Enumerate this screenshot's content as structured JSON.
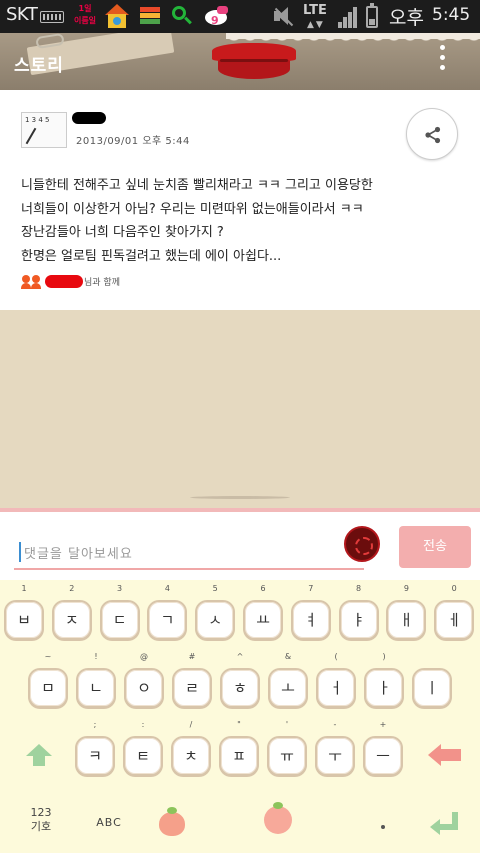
{
  "status_bar": {
    "carrier": "SKT",
    "calendar_day": "1일",
    "calendar_weekday": "이름일",
    "kitty_badge": "9",
    "network": "LTE",
    "ampm": "오후",
    "time": "5:45"
  },
  "app_bar": {
    "title": "스토리"
  },
  "post": {
    "date": "2013/09/01 오후 5:44",
    "thumbnail_text": "1 3 4 5",
    "lines": [
      "니들한테 전해주고 싶네 눈치좀 빨리채라고 ㅋㅋ 그리고 이용당한",
      "너희들이 이상한거 아님? 우리는 미련따위 없는애들이라서 ㅋㅋ",
      "장난감들아 너희 다음주인 찾아가지 ?",
      "한명은 얼로팀 핀독걸려고 했는데 에이 아쉽다..."
    ],
    "tag_suffix": "님과 함께"
  },
  "comment_bar": {
    "placeholder": "댓글을 달아보세요",
    "send_label": "전송"
  },
  "keyboard": {
    "row1": [
      {
        "key": "ㅂ",
        "hint": "1"
      },
      {
        "key": "ㅈ",
        "hint": "2"
      },
      {
        "key": "ㄷ",
        "hint": "3"
      },
      {
        "key": "ㄱ",
        "hint": "4"
      },
      {
        "key": "ㅅ",
        "hint": "5"
      },
      {
        "key": "ㅛ",
        "hint": "6"
      },
      {
        "key": "ㅕ",
        "hint": "7"
      },
      {
        "key": "ㅑ",
        "hint": "8"
      },
      {
        "key": "ㅐ",
        "hint": "9"
      },
      {
        "key": "ㅔ",
        "hint": "0"
      }
    ],
    "row2": [
      {
        "key": "ㅁ",
        "hint": "~"
      },
      {
        "key": "ㄴ",
        "hint": "!"
      },
      {
        "key": "ㅇ",
        "hint": "@"
      },
      {
        "key": "ㄹ",
        "hint": "#"
      },
      {
        "key": "ㅎ",
        "hint": "^"
      },
      {
        "key": "ㅗ",
        "hint": "&"
      },
      {
        "key": "ㅓ",
        "hint": "("
      },
      {
        "key": "ㅏ",
        "hint": ")"
      },
      {
        "key": "ㅣ",
        "hint": ""
      }
    ],
    "row3": [
      {
        "key": "ㅋ",
        "hint": ";"
      },
      {
        "key": "ㅌ",
        "hint": ":"
      },
      {
        "key": "ㅊ",
        "hint": "/"
      },
      {
        "key": "ㅍ",
        "hint": "\""
      },
      {
        "key": "ㅠ",
        "hint": "'"
      },
      {
        "key": "ㅜ",
        "hint": "-"
      },
      {
        "key": "ㅡ",
        "hint": "+"
      }
    ],
    "num_mode_top": "123",
    "num_mode_bottom": "기호",
    "abc_mode": "ABC"
  },
  "colors": {
    "accent_pink": "#f3aeae",
    "tag_red": "#e8090f",
    "people_orange": "#f05a24",
    "keyboard_bg": "#fdfadb"
  }
}
